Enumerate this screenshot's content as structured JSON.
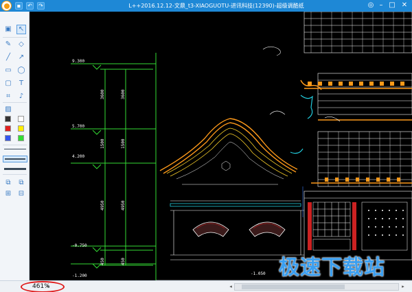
{
  "window": {
    "title": "L++2016.12.12-文鼎_t3-XIAOGUOTU-进讯科技(12390)-超级调酷纸",
    "controls": [
      "menu",
      "minimize",
      "maximize",
      "close"
    ]
  },
  "toolbar": {
    "tools": [
      "select-icon",
      "pointer-icon",
      "pencil-icon",
      "eraser-icon",
      "line-icon",
      "arrow-icon",
      "rectangle-icon",
      "ellipse-icon",
      "rounded-rect-icon",
      "text-icon",
      "crop-icon",
      "microphone-icon",
      "image-icon"
    ],
    "colors": [
      "#333333",
      "#ffffff",
      "#e02020",
      "#ffee00",
      "#3355ee",
      "#33dd33"
    ],
    "line_widths": [
      "thin",
      "medium",
      "thick"
    ]
  },
  "drawing": {
    "elevation_labels": [
      "9.300",
      "5.700",
      "4.200",
      "-0.750",
      "-1.200",
      "-1.050"
    ],
    "dimension_labels": [
      "3600",
      "3600",
      "1500",
      "1500",
      "4950",
      "4950",
      "450",
      "450"
    ],
    "colors": {
      "roof_orange": "#ff9a1a",
      "roof_yellow": "#ffd42a",
      "green_line": "#33dd33",
      "cyan": "#22ccdd",
      "wall_white": "#ffffff",
      "timber_red": "#cc2222",
      "grid_blue": "#2f5fbf"
    }
  },
  "status": {
    "zoom": "461%"
  },
  "watermark": "极速下载站"
}
